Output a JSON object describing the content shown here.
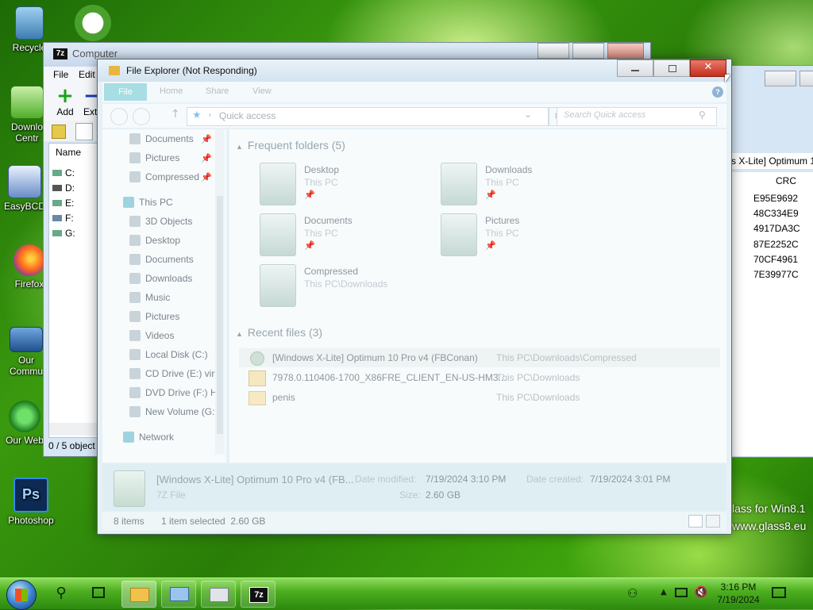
{
  "desktop": {
    "icons": [
      {
        "label": "Recycle",
        "icon": "recycle-bin-icon"
      },
      {
        "label": "",
        "icon": "utorrent-icon"
      },
      {
        "label": "Downlo",
        "label2": "Centr",
        "icon": "download-center-icon"
      },
      {
        "label": "EasyBCD",
        "icon": "easybcd-icon"
      },
      {
        "label": "Firefox",
        "icon": "firefox-icon"
      },
      {
        "label": "Our",
        "label2": "Commu",
        "icon": "forum-icon"
      },
      {
        "label": "Our Web",
        "icon": "website-icon"
      },
      {
        "label": "Photoshop",
        "icon": "photoshop-icon"
      }
    ],
    "watermark_line1": "lass for Win8.1",
    "watermark_line2": "www.glass8.eu"
  },
  "zip_window": {
    "title": "Computer",
    "menu": [
      "File",
      "Edit"
    ],
    "toolbar": [
      "Add",
      "Extr"
    ],
    "name_header": "Name",
    "drives": [
      "C:",
      "D:",
      "E:",
      "F:",
      "G:"
    ],
    "status": "0 / 5 object"
  },
  "zip_right": {
    "path_text": "s X-Lite] Optimum 1",
    "crc_header": "CRC",
    "crc_values": [
      "E95E9692",
      "48C334E9",
      "4917DA3C",
      "87E2252C",
      "70CF4961",
      "7E39977C"
    ]
  },
  "explorer": {
    "title": "File Explorer (Not Responding)",
    "ribbon_tabs": [
      "File",
      "Home",
      "Share",
      "View"
    ],
    "address": "Quick access",
    "search_placeholder": "Search Quick access",
    "nav": {
      "pinned": [
        "Documents",
        "Pictures",
        "Compressed"
      ],
      "this_pc": "This PC",
      "pc_items": [
        "3D Objects",
        "Desktop",
        "Documents",
        "Downloads",
        "Music",
        "Pictures",
        "Videos",
        "Local Disk (C:)",
        "CD Drive (E:) virt",
        "DVD Drive (F:) H",
        "New Volume (G:"
      ],
      "network": "Network"
    },
    "frequent_header": "Frequent folders (5)",
    "frequent": [
      {
        "name": "Desktop",
        "location": "This PC",
        "pinned": true
      },
      {
        "name": "Downloads",
        "location": "This PC",
        "pinned": true
      },
      {
        "name": "Documents",
        "location": "This PC",
        "pinned": true
      },
      {
        "name": "Pictures",
        "location": "This PC",
        "pinned": true
      },
      {
        "name": "Compressed",
        "location": "This PC\\Downloads",
        "pinned": false
      }
    ],
    "recent_header": "Recent files (3)",
    "recent": [
      {
        "name": "[Windows X-Lite] Optimum 10 Pro v4 (FBConan)",
        "path": "This PC\\Downloads\\Compressed"
      },
      {
        "name": "7978.0.110406-1700_X86FRE_CLIENT_EN-US-HM3...",
        "path": "This PC\\Downloads"
      },
      {
        "name": "penis",
        "path": "This PC\\Downloads"
      }
    ],
    "details": {
      "name": "[Windows X-Lite] Optimum 10 Pro v4 (FB...",
      "type": "7Z File",
      "modified_label": "Date modified:",
      "modified": "7/19/2024 3:10 PM",
      "created_label": "Date created:",
      "created": "7/19/2024 3:01 PM",
      "size_label": "Size:",
      "size": "2.60 GB"
    },
    "status": {
      "items": "8 items",
      "selected": "1 item selected  2.60 GB"
    }
  },
  "taskbar": {
    "time": "3:16 PM",
    "date": "7/19/2024",
    "buttons": [
      "start-button",
      "search-icon",
      "task-view-icon",
      "file-explorer-icon",
      "computer-icon",
      "easybcd-task-icon",
      "7zip-icon"
    ]
  }
}
